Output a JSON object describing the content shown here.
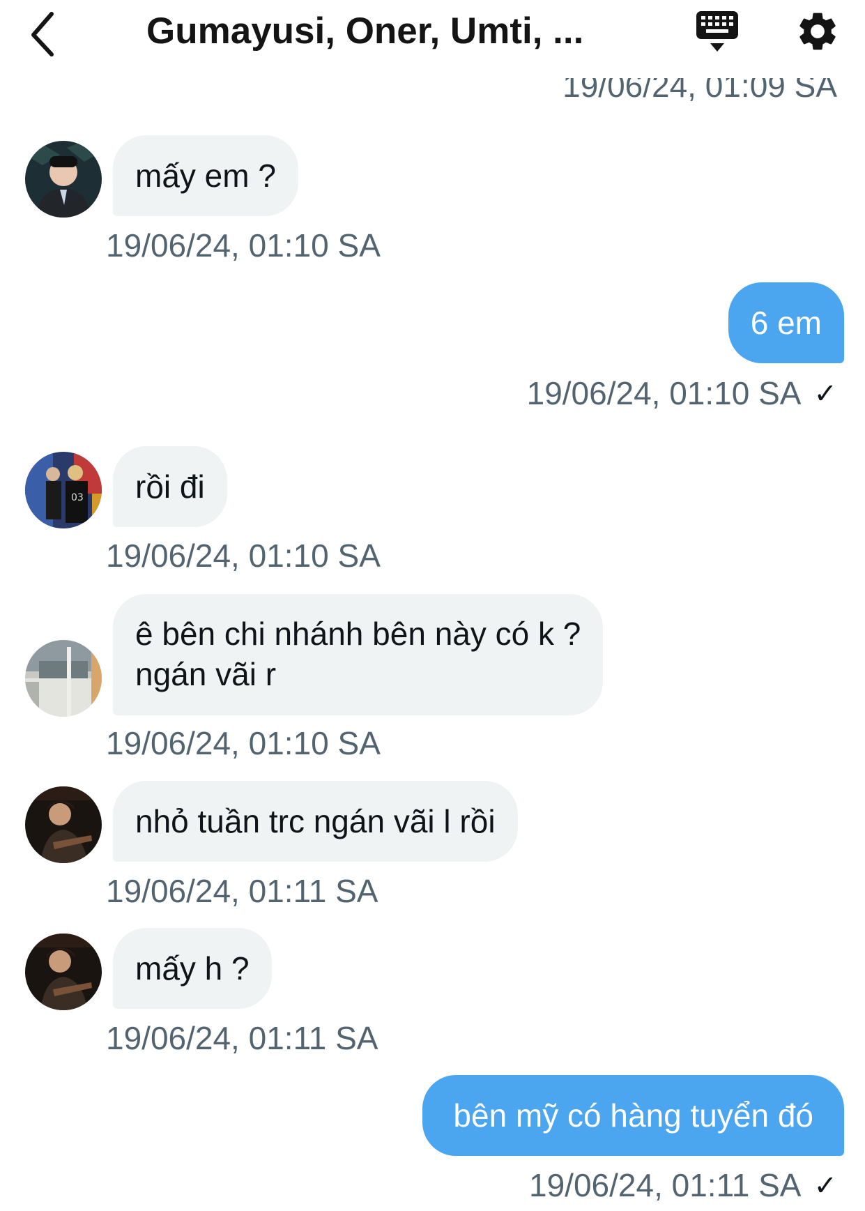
{
  "header": {
    "title": "Gumayusi, Oner, Umti, ...",
    "back_icon": "chevron-left-icon",
    "keyboard_icon": "keyboard-icon",
    "settings_icon": "gear-icon"
  },
  "cut_off_timestamp": "19/06/24, 01:09 SA",
  "colors": {
    "outgoing_bubble": "#4ca5ef",
    "incoming_bubble": "#eff3f4",
    "timestamp": "#536471"
  },
  "messages": [
    {
      "direction": "in",
      "text": "mấy em ?",
      "time": "19/06/24, 01:10 SA"
    },
    {
      "direction": "out",
      "text": "6 em",
      "time": "19/06/24, 01:10 SA",
      "status": "✓"
    },
    {
      "direction": "in",
      "text": "rồi đi",
      "time": "19/06/24, 01:10 SA"
    },
    {
      "direction": "in",
      "line1": "ê bên chi nhánh bên này có k ?",
      "line2": "ngán vãi r",
      "time": "19/06/24, 01:10 SA"
    },
    {
      "direction": "in",
      "text": "nhỏ tuần trc ngán vãi l rồi",
      "time": "19/06/24, 01:11 SA"
    },
    {
      "direction": "in",
      "text": "mấy h ?",
      "time": "19/06/24, 01:11 SA"
    },
    {
      "direction": "out",
      "text": "bên mỹ có  hàng tuyển đó",
      "time": "19/06/24, 01:11 SA",
      "status": "✓"
    }
  ]
}
